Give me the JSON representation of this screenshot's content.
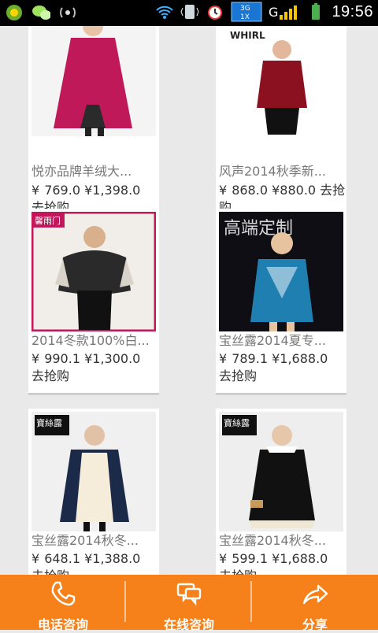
{
  "statusbar": {
    "time": "19:56",
    "network_top": "3G",
    "network_bottom": "1X",
    "signal_label": "G",
    "icons": [
      "app-icon",
      "wechat-icon",
      "broadcast-icon",
      "wifi-icon",
      "vibrate-icon",
      "alarm-icon",
      "data-icon",
      "signal-icon",
      "battery-icon"
    ]
  },
  "products": [
    {
      "title": "悦亦品牌羊绒大...",
      "price_cur": "¥",
      "price_sale": "769.0",
      "price_orig": "¥1,398.0",
      "cta": "去抢购"
    },
    {
      "title": "风声2014秋季新...",
      "price_cur": "¥",
      "price_sale": "868.0",
      "price_orig": "¥880.0",
      "cta": "去抢购"
    },
    {
      "title": "2014冬款100%白...",
      "price_cur": "¥",
      "price_sale": "990.1",
      "price_orig": "¥1,300.0",
      "cta": "去抢购"
    },
    {
      "title": "宝丝露2014夏专...",
      "price_cur": "¥",
      "price_sale": "789.1",
      "price_orig": "¥1,688.0",
      "cta": "去抢购"
    },
    {
      "title": "宝丝露2014秋冬...",
      "price_cur": "¥",
      "price_sale": "648.1",
      "price_orig": "¥1,388.0",
      "cta": "去抢购"
    },
    {
      "title": "宝丝露2014秋冬...",
      "price_cur": "¥",
      "price_sale": "599.1",
      "price_orig": "¥1,688.0",
      "cta": "去抢购"
    }
  ],
  "image_marks": {
    "brand_whirl": "WHIRL",
    "brand_yuyumen": "馨雨门",
    "brand_baosilu": "寶絲露",
    "ad_text": "高端定制"
  },
  "bottom_nav": {
    "phone_label": "电话咨询",
    "chat_label": "在线咨询",
    "share_label": "分享"
  },
  "colors": {
    "accent": "#f6811a",
    "coat_magenta": "#c0195a",
    "blouse_red": "#8b1020",
    "frame_pink": "#c2185b",
    "dress_blue": "#1f7fb0",
    "dress_navy": "#1c2a4a"
  }
}
